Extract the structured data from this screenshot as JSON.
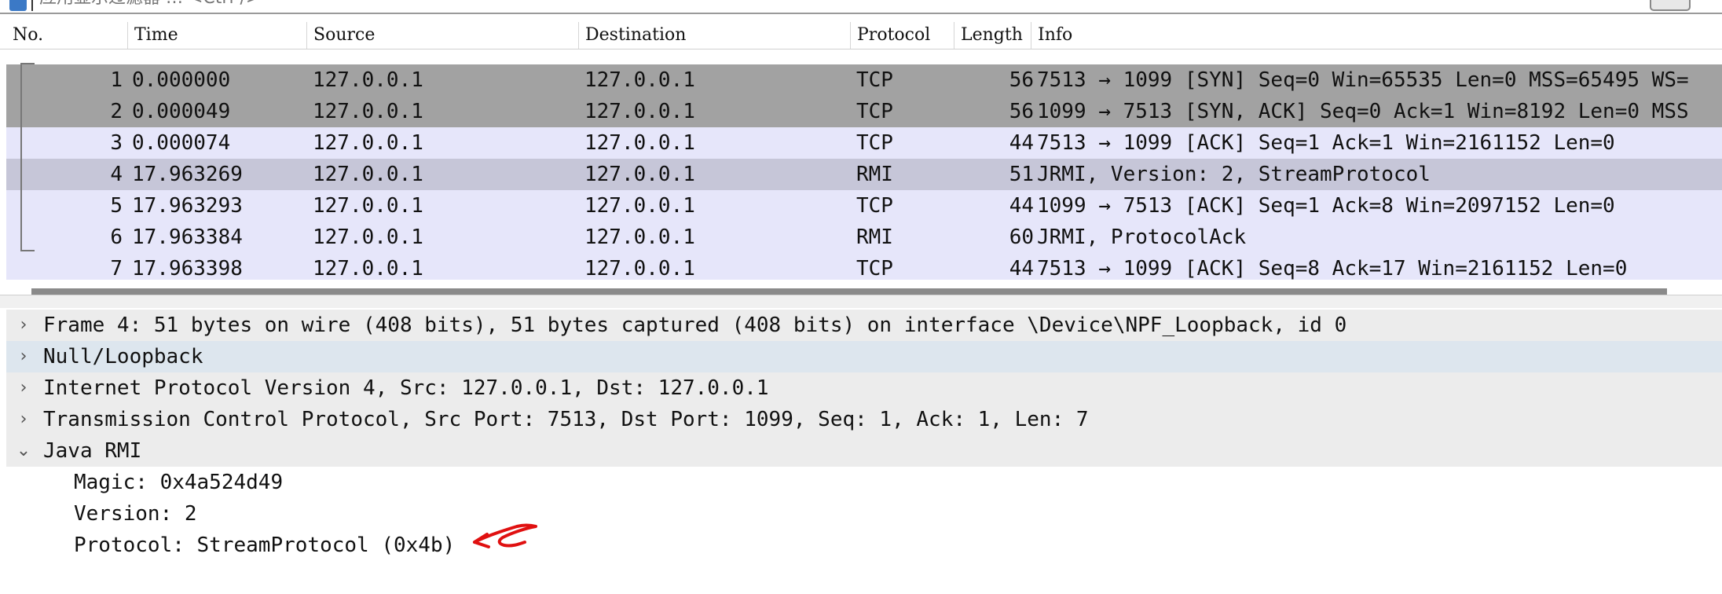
{
  "filter": {
    "placeholder": "应用显示过滤器 … <Ctrl-/>"
  },
  "packet_list": {
    "columns": [
      "No.",
      "Time",
      "Source",
      "Destination",
      "Protocol",
      "Length",
      "Info"
    ],
    "rows": [
      {
        "no": "1",
        "time": "0.000000",
        "source": "127.0.0.1",
        "destination": "127.0.0.1",
        "protocol": "TCP",
        "length": "56",
        "info": "7513 → 1099 [SYN] Seq=0 Win=65535 Len=0 MSS=65495 WS="
      },
      {
        "no": "2",
        "time": "0.000049",
        "source": "127.0.0.1",
        "destination": "127.0.0.1",
        "protocol": "TCP",
        "length": "56",
        "info": "1099 → 7513 [SYN, ACK] Seq=0 Ack=1 Win=8192 Len=0 MSS"
      },
      {
        "no": "3",
        "time": "0.000074",
        "source": "127.0.0.1",
        "destination": "127.0.0.1",
        "protocol": "TCP",
        "length": "44",
        "info": "7513 → 1099 [ACK] Seq=1 Ack=1 Win=2161152 Len=0"
      },
      {
        "no": "4",
        "time": "17.963269",
        "source": "127.0.0.1",
        "destination": "127.0.0.1",
        "protocol": "RMI",
        "length": "51",
        "info": "JRMI, Version: 2, StreamProtocol"
      },
      {
        "no": "5",
        "time": "17.963293",
        "source": "127.0.0.1",
        "destination": "127.0.0.1",
        "protocol": "TCP",
        "length": "44",
        "info": "1099 → 7513 [ACK] Seq=1 Ack=8 Win=2097152 Len=0"
      },
      {
        "no": "6",
        "time": "17.963384",
        "source": "127.0.0.1",
        "destination": "127.0.0.1",
        "protocol": "RMI",
        "length": "60",
        "info": "JRMI, ProtocolAck"
      },
      {
        "no": "7",
        "time": "17.963398",
        "source": "127.0.0.1",
        "destination": "127.0.0.1",
        "protocol": "TCP",
        "length": "44",
        "info": "7513 → 1099 [ACK] Seq=8 Ack=17 Win=2161152 Len=0"
      }
    ],
    "selected_row": "4"
  },
  "details": {
    "items": [
      {
        "text": "Frame 4: 51 bytes on wire (408 bits), 51 bytes captured (408 bits) on interface \\Device\\NPF_Loopback, id 0",
        "expanded": false
      },
      {
        "text": "Null/Loopback",
        "expanded": false
      },
      {
        "text": "Internet Protocol Version 4, Src: 127.0.0.1, Dst: 127.0.0.1",
        "expanded": false
      },
      {
        "text": "Transmission Control Protocol, Src Port: 7513, Dst Port: 1099, Seq: 1, Ack: 1, Len: 7",
        "expanded": false
      },
      {
        "text": "Java RMI",
        "expanded": true
      }
    ],
    "rmi_fields": [
      "Magic: 0x4a524d49",
      "Version: 2",
      "Protocol: StreamProtocol (0x4b)"
    ],
    "collapsed_glyph": "›",
    "expanded_glyph": "⌄"
  },
  "colors": {
    "syn_row": "#a2a2a2",
    "tcp_row": "#e6e6fa",
    "selected_row": "#c6c6d8",
    "annotation": "#e01010"
  }
}
